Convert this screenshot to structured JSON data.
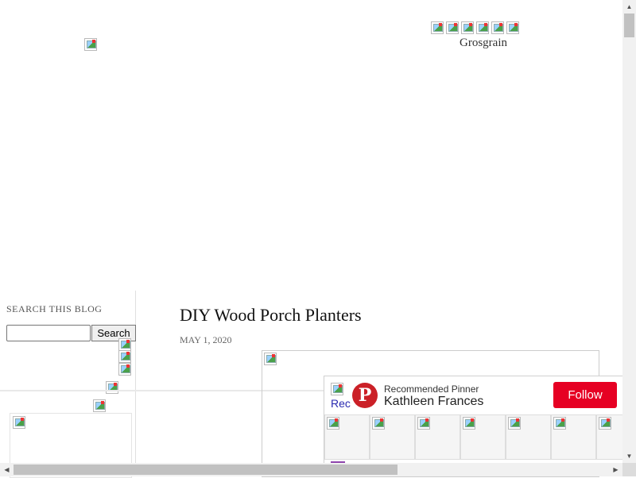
{
  "header": {
    "brand_text": "Grosgrain",
    "social_icons": [
      "social-icon-1",
      "social-icon-2",
      "social-icon-3",
      "social-icon-4",
      "social-icon-5",
      "social-icon-6"
    ]
  },
  "sidebar": {
    "search_heading": "SEARCH THIS BLOG",
    "search_input_value": "",
    "search_button_label": "Search"
  },
  "post": {
    "title": "DIY Wood Porch Planters",
    "date": "MAY 1, 2020"
  },
  "pinterest": {
    "avatar_alt": "Rec",
    "logo_glyph": "P",
    "recommended_label": "Recommended Pinner",
    "pinner_name": "Kathleen Frances",
    "follow_label": "Follow",
    "follow_color": "#e60023"
  },
  "scrollbars": {
    "up_arrow": "▲",
    "down_arrow": "▼",
    "left_arrow": "◀",
    "right_arrow": "▶"
  }
}
